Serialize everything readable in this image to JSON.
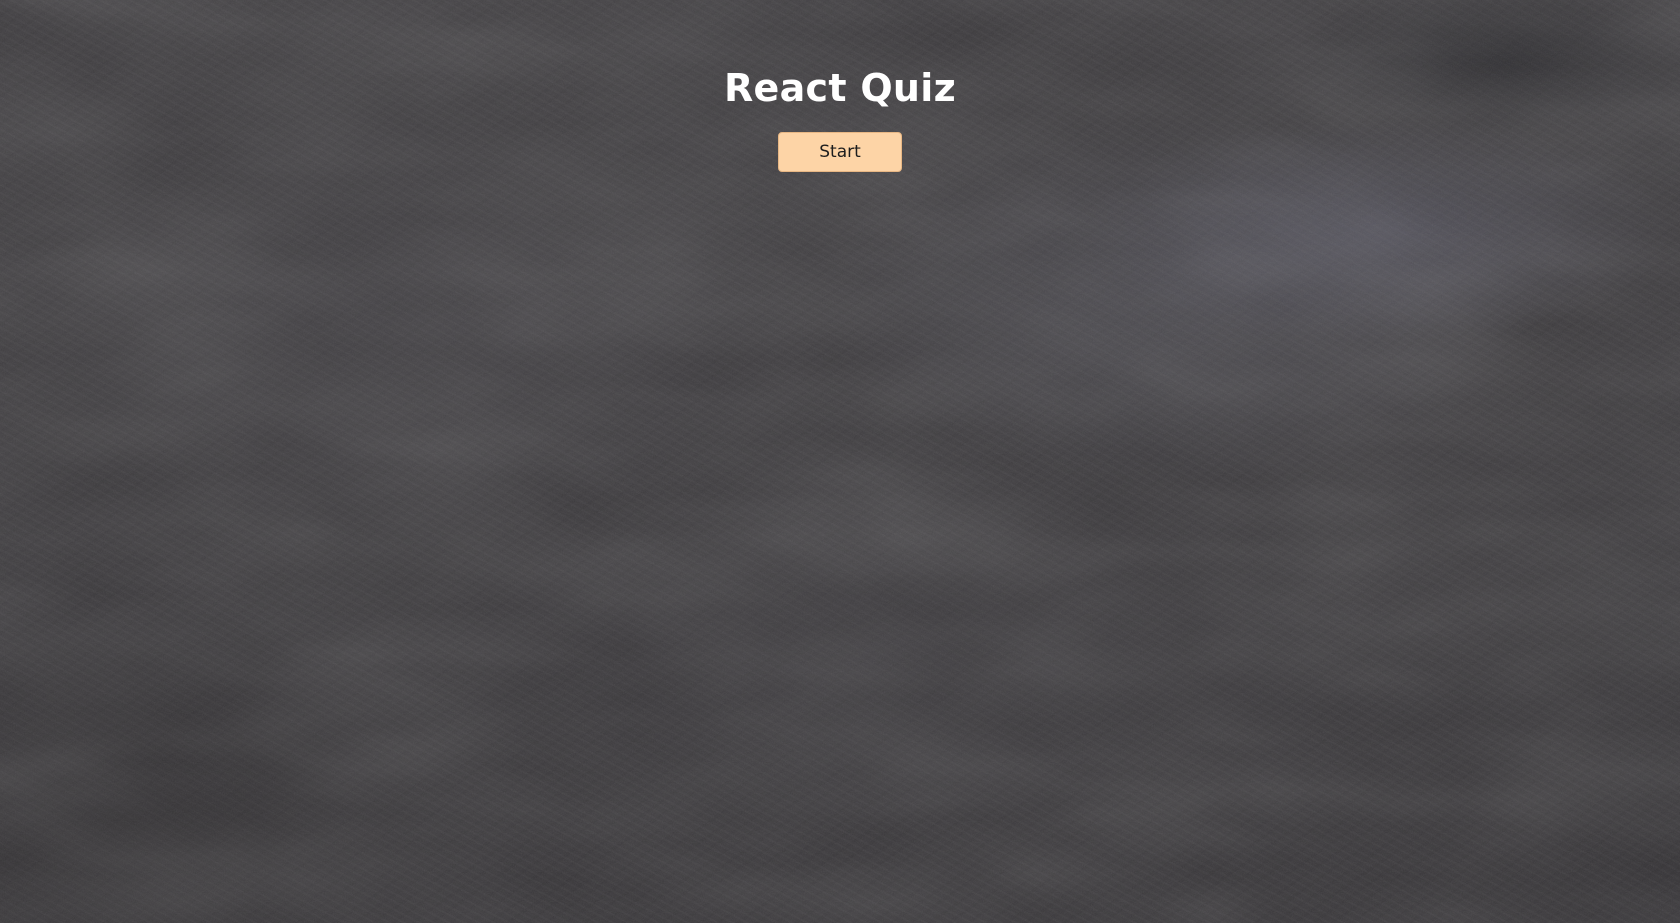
{
  "app": {
    "title": "React Quiz",
    "start_label": "Start"
  },
  "colors": {
    "background": "#3a383b",
    "title_text": "#ffffff",
    "button_bg": "#fdd4a6",
    "button_text": "#1d1d1d"
  },
  "background": {
    "texture": "chalkboard"
  }
}
